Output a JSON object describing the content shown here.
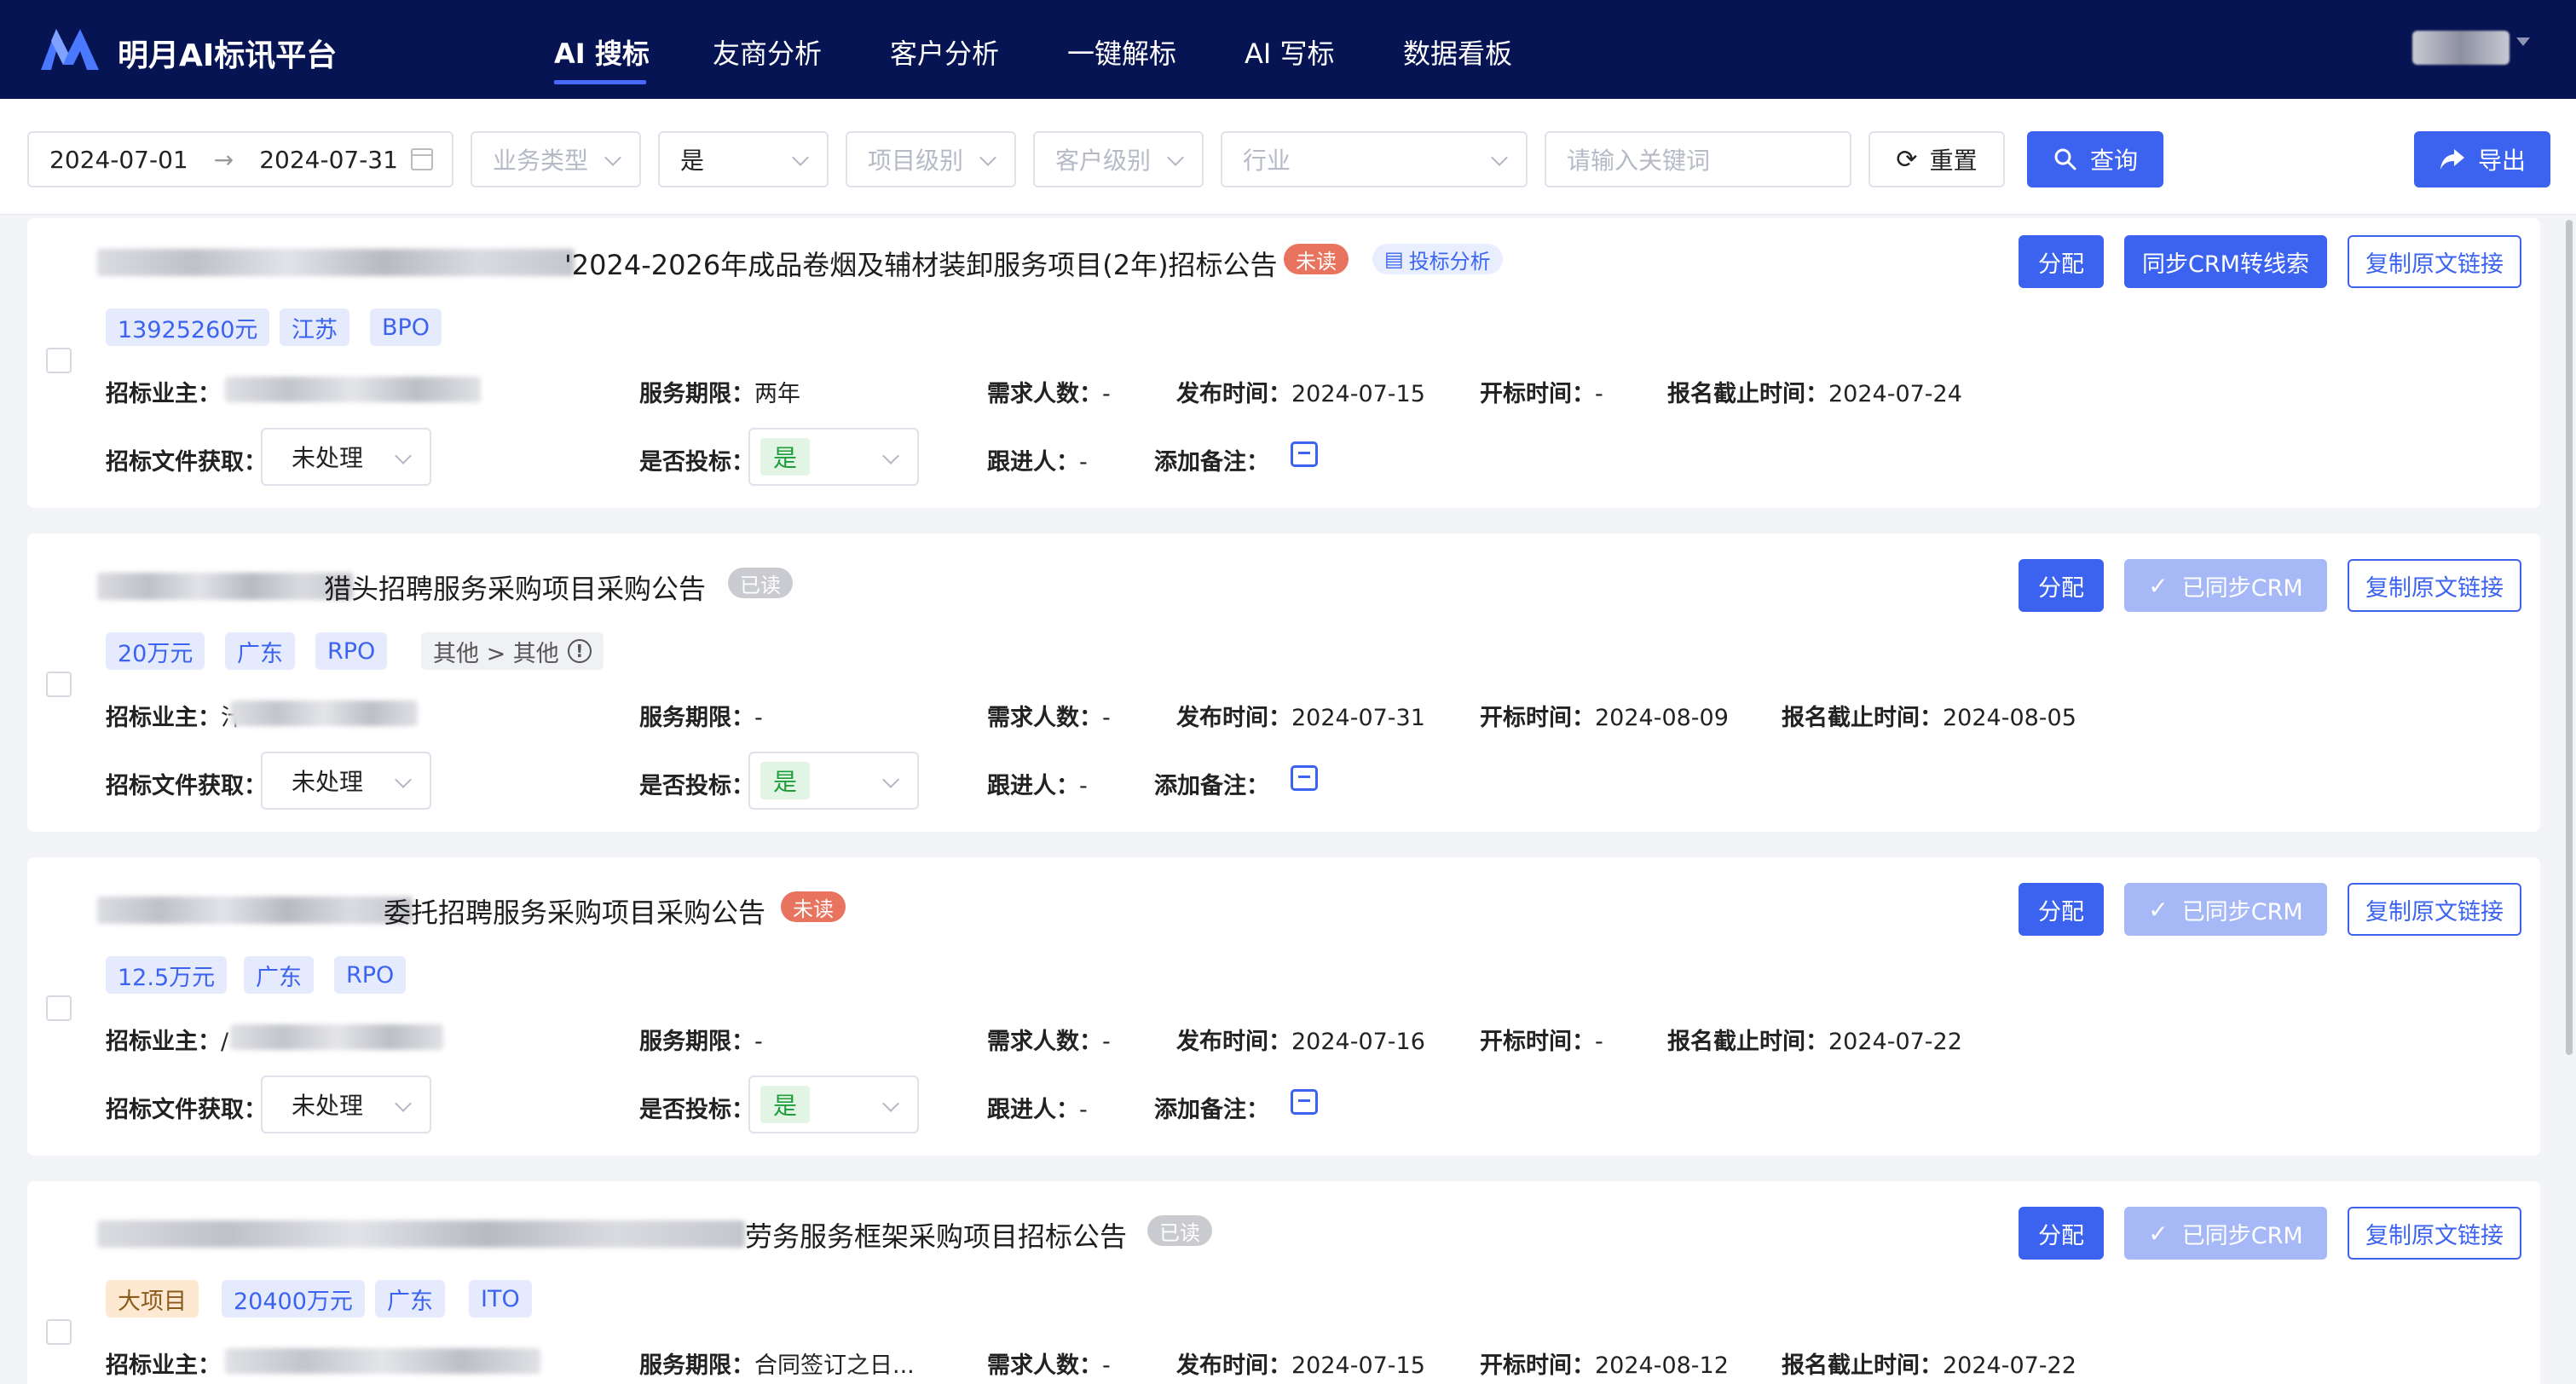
{
  "app": {
    "brand": "明月AI标讯平台",
    "accent": "#3c63ef",
    "nav_bg": "#071453"
  },
  "nav": {
    "tabs": [
      {
        "label": "AI 搜标",
        "active": true
      },
      {
        "label": "友商分析"
      },
      {
        "label": "客户分析"
      },
      {
        "label": "一键解标"
      },
      {
        "label": "AI 写标"
      },
      {
        "label": "数据看板"
      }
    ]
  },
  "filters": {
    "date_start": "2024-07-01",
    "date_arrow": "→",
    "date_end": "2024-07-31",
    "business_type_placeholder": "业务类型",
    "yes_value": "是",
    "project_level_placeholder": "项目级别",
    "customer_level_placeholder": "客户级别",
    "industry_placeholder": "行业",
    "keyword_placeholder": "请输入关键词",
    "reset_label": "重置",
    "search_label": "查询",
    "export_label": "导出"
  },
  "labels": {
    "owner": "招标业主：",
    "service_period": "服务期限：",
    "headcount": "需求人数：",
    "publish_time": "发布时间：",
    "open_time": "开标时间：",
    "deadline": "报名截止时间：",
    "doc_get": "招标文件获取：",
    "is_bid": "是否投标：",
    "follower": "跟进人：",
    "add_note": "添加备注：",
    "assign": "分配",
    "sync_crm": "同步CRM转线索",
    "synced_crm": "已同步CRM",
    "copy_link": "复制原文链接",
    "analysis_tag": "投标分析"
  },
  "rows": [
    {
      "title_visible": "'2024-2026年成品卷烟及辅材装卸服务项目(2年)招标公告",
      "status": "未读",
      "tags": [
        "13925260元",
        "江苏",
        "BPO"
      ],
      "owner_prefix": "",
      "service_period": "两年",
      "headcount": "-",
      "publish_time": "2024-07-15",
      "open_time": "-",
      "deadline": "2024-07-24",
      "doc_status": "未处理",
      "is_bid": "是",
      "follower": "-"
    },
    {
      "title_visible": "猎头招聘服务采购项目采购公告",
      "status": "已读",
      "tags": [
        "20万元",
        "广东",
        "RPO"
      ],
      "extra_tag": "其他 > 其他",
      "owner_prefix": "汁",
      "service_period": "-",
      "headcount": "-",
      "publish_time": "2024-07-31",
      "open_time": "2024-08-09",
      "deadline": "2024-08-05",
      "doc_status": "未处理",
      "is_bid": "是",
      "follower": "-"
    },
    {
      "title_visible": "委托招聘服务采购项目采购公告",
      "status": "未读",
      "tags": [
        "12.5万元",
        "广东",
        "RPO"
      ],
      "owner_prefix": "/",
      "service_period": "-",
      "headcount": "-",
      "publish_time": "2024-07-16",
      "open_time": "-",
      "deadline": "2024-07-22",
      "doc_status": "未处理",
      "is_bid": "是",
      "follower": "-"
    },
    {
      "title_visible": "劳务服务框架采购项目招标公告",
      "status": "已读",
      "big_tag": "大项目",
      "tags": [
        "20400万元",
        "广东",
        "ITO"
      ],
      "owner_prefix": "",
      "service_period": "合同签订之日...",
      "headcount": "-",
      "publish_time": "2024-07-15",
      "open_time": "2024-08-12",
      "deadline": "2024-07-22"
    }
  ]
}
